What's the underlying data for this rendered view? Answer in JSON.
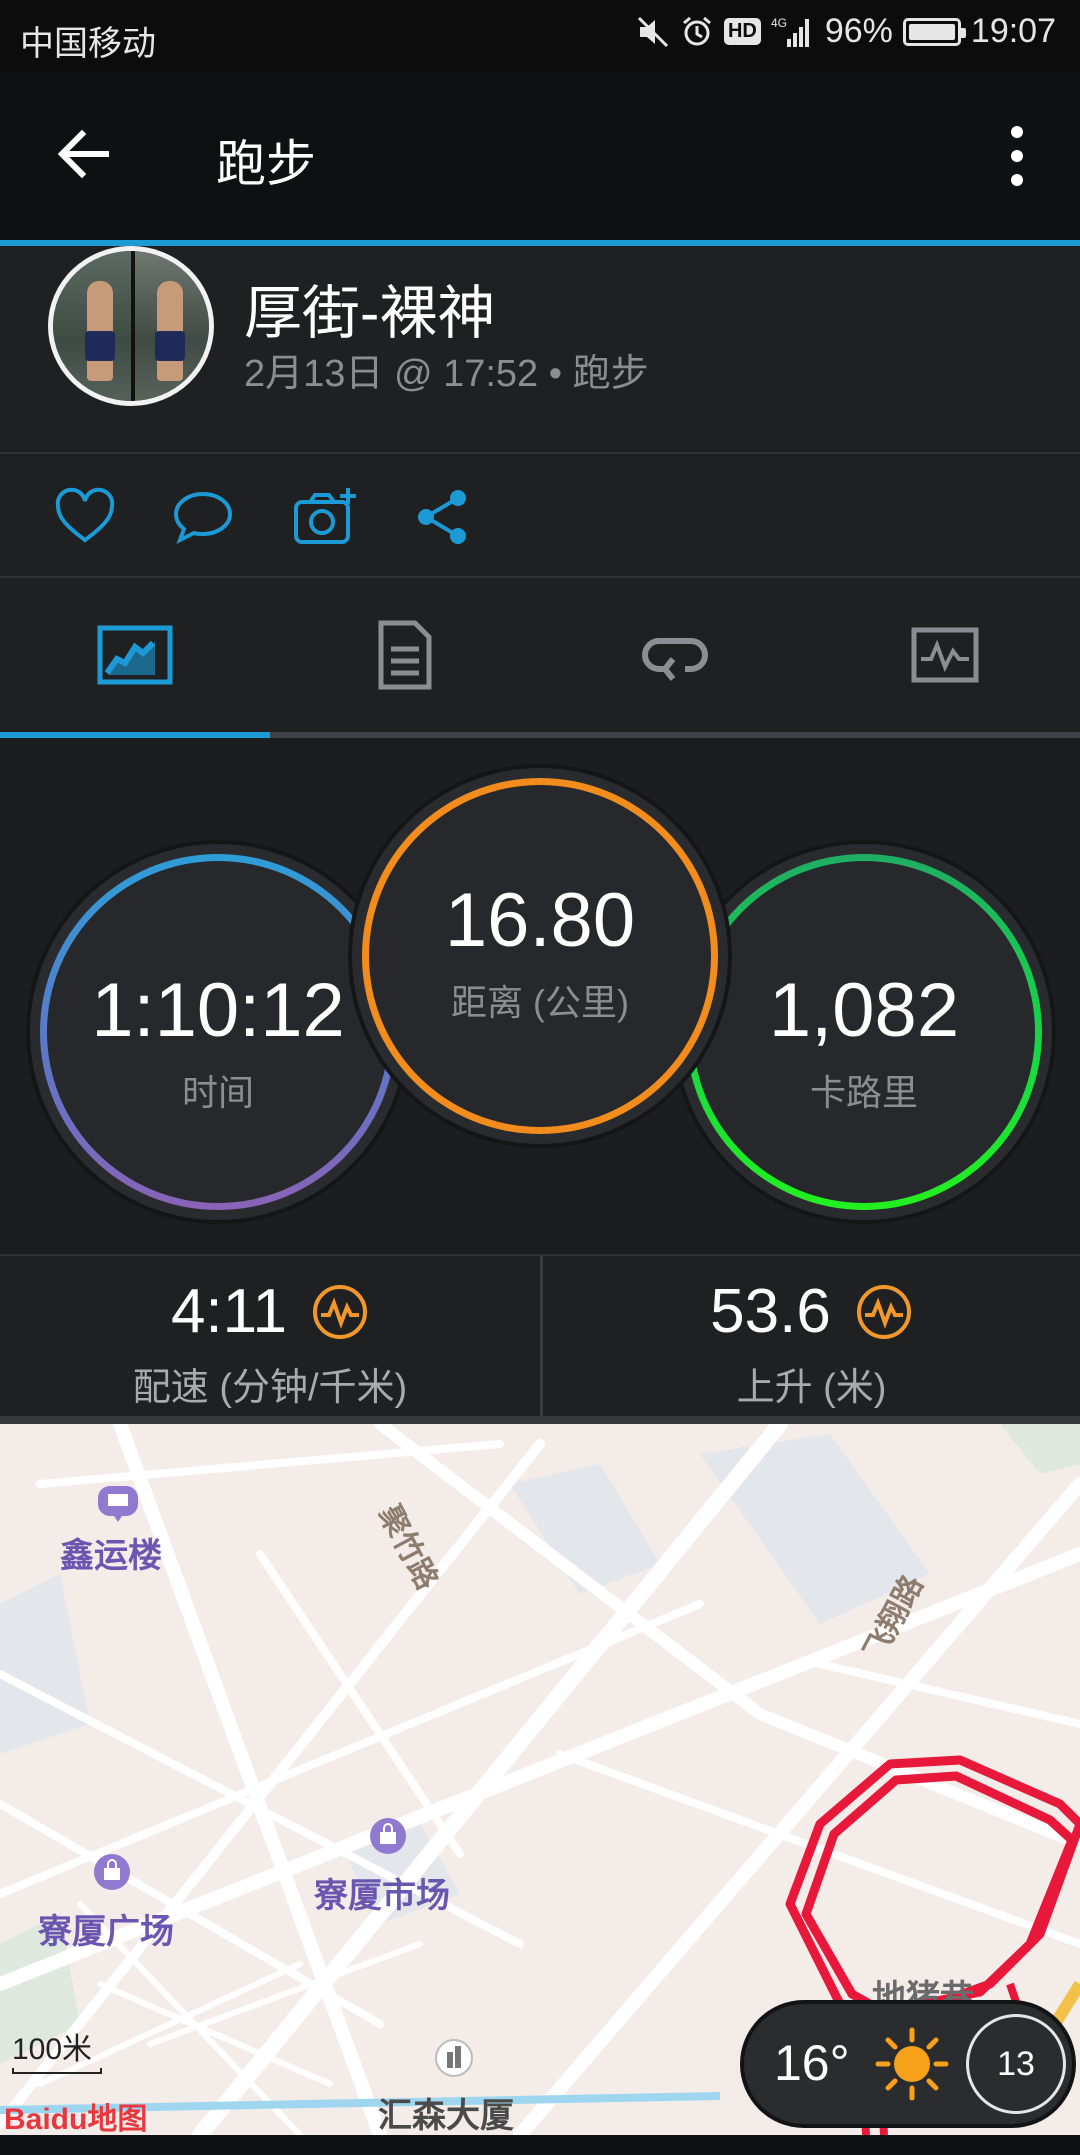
{
  "status_bar": {
    "carrier": "中国移动",
    "network": "4G",
    "hd": "HD",
    "battery": "96%",
    "time": "19:07"
  },
  "app_bar": {
    "title": "跑步"
  },
  "activity": {
    "user_name": "厚街-裸神",
    "meta": "2月13日 @ 17:52 • 跑步"
  },
  "tabs": [
    {
      "name": "overview",
      "icon": "stats-chart-icon",
      "active": true
    },
    {
      "name": "details",
      "icon": "document-list-icon",
      "active": false
    },
    {
      "name": "laps",
      "icon": "loop-arrow-icon",
      "active": false
    },
    {
      "name": "charts",
      "icon": "activity-graph-icon",
      "active": false
    }
  ],
  "stats": {
    "time": {
      "value": "1:10:12",
      "label": "时间"
    },
    "distance": {
      "value": "16.80",
      "label": "距离 (公里)"
    },
    "calories": {
      "value": "1,082",
      "label": "卡路里"
    }
  },
  "metrics": {
    "pace": {
      "value": "4:11",
      "label": "配速 (分钟/千米)"
    },
    "elevation": {
      "value": "53.6",
      "label": "上升 (米)"
    }
  },
  "map": {
    "pois": [
      "鑫运楼",
      "寮厦市场",
      "寮厦广场",
      "汇森大厦",
      "地猪巷"
    ],
    "roads": [
      "聚竹路",
      "飞翔路"
    ],
    "scale": "100米",
    "provider": "Baidu地图",
    "weather_temp": "16°",
    "zoom": "13",
    "colors": {
      "route": "#e8183a",
      "background": "#f3ece9"
    }
  },
  "colors": {
    "accent": "#1c9ad6",
    "time_ring": "#3d8fd8",
    "distance_ring": "#f18c1d",
    "calories_ring": "#1fd144",
    "metric_icon": "#f0982a"
  }
}
